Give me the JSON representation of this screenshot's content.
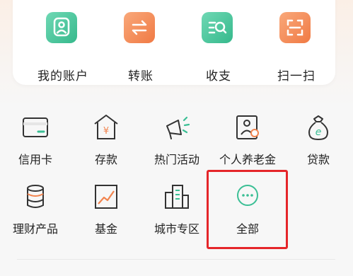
{
  "top_shortcuts": [
    {
      "label": "我的账户",
      "icon": "account-icon",
      "color": "#3bbf95"
    },
    {
      "label": "转账",
      "icon": "transfer-icon",
      "color": "#f2844e"
    },
    {
      "label": "收支",
      "icon": "income-expense-icon",
      "color": "#3bbf95"
    },
    {
      "label": "扫一扫",
      "icon": "scan-icon",
      "color": "#f2844e"
    }
  ],
  "grid_items": [
    {
      "label": "信用卡",
      "icon": "credit-card-icon"
    },
    {
      "label": "存款",
      "icon": "deposit-icon"
    },
    {
      "label": "热门活动",
      "icon": "megaphone-icon"
    },
    {
      "label": "个人养老金",
      "icon": "pension-icon"
    },
    {
      "label": "贷款",
      "icon": "loan-bag-icon"
    },
    {
      "label": "理财产品",
      "icon": "coin-stack-icon"
    },
    {
      "label": "基金",
      "icon": "fund-chart-icon"
    },
    {
      "label": "城市专区",
      "icon": "city-building-icon"
    },
    {
      "label": "全部",
      "icon": "more-dots-icon"
    }
  ],
  "colors": {
    "accent_green": "#3bbf95",
    "accent_orange": "#f2844e",
    "icon_stroke": "#333333",
    "highlight_red": "#e5262a"
  }
}
